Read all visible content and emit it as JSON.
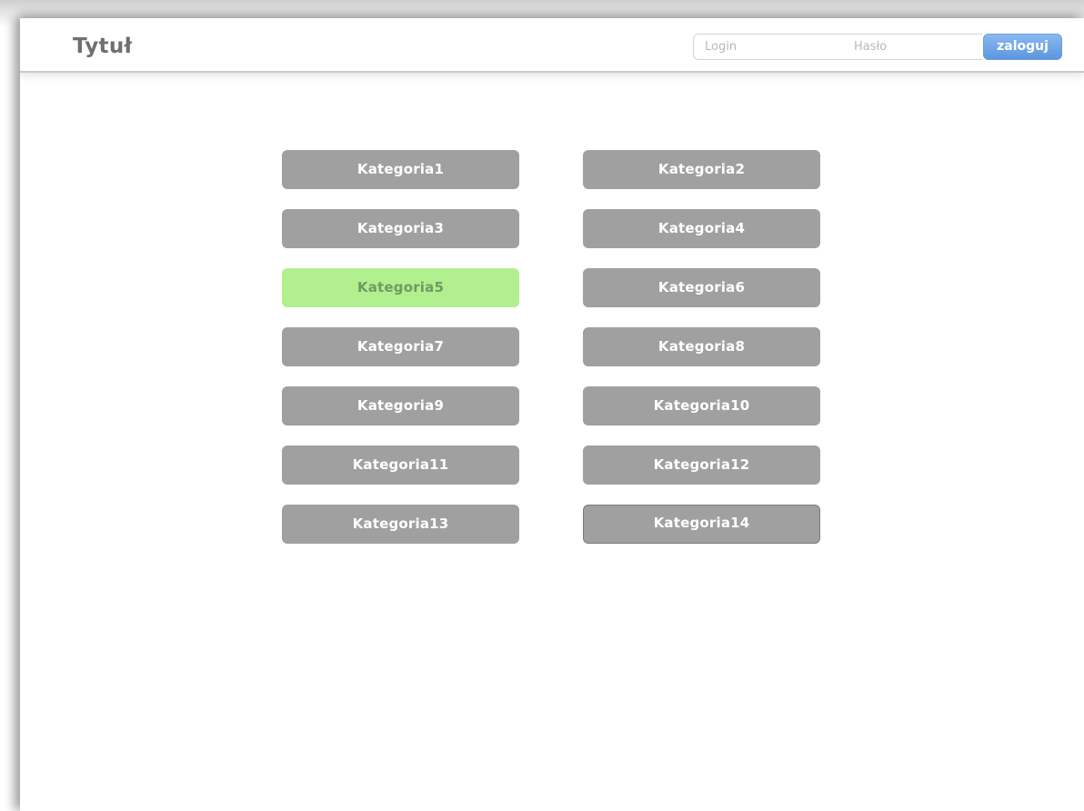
{
  "header": {
    "title": "Tytuł",
    "login": {
      "placeholder": "Login"
    },
    "password": {
      "placeholder": "Hasło"
    },
    "login_button_label": "zaloguj",
    "accent_color": "#6ea3e6"
  },
  "categories": {
    "selected": "Kategoria5",
    "selected_color": "#b2ef8f",
    "default_color": "#a0a0a0",
    "items": [
      "Kategoria1",
      "Kategoria2",
      "Kategoria3",
      "Kategoria4",
      "Kategoria5",
      "Kategoria6",
      "Kategoria7",
      "Kategoria8",
      "Kategoria9",
      "Kategoria10",
      "Kategoria11",
      "Kategoria12",
      "Kategoria13",
      "Kategoria14"
    ]
  }
}
